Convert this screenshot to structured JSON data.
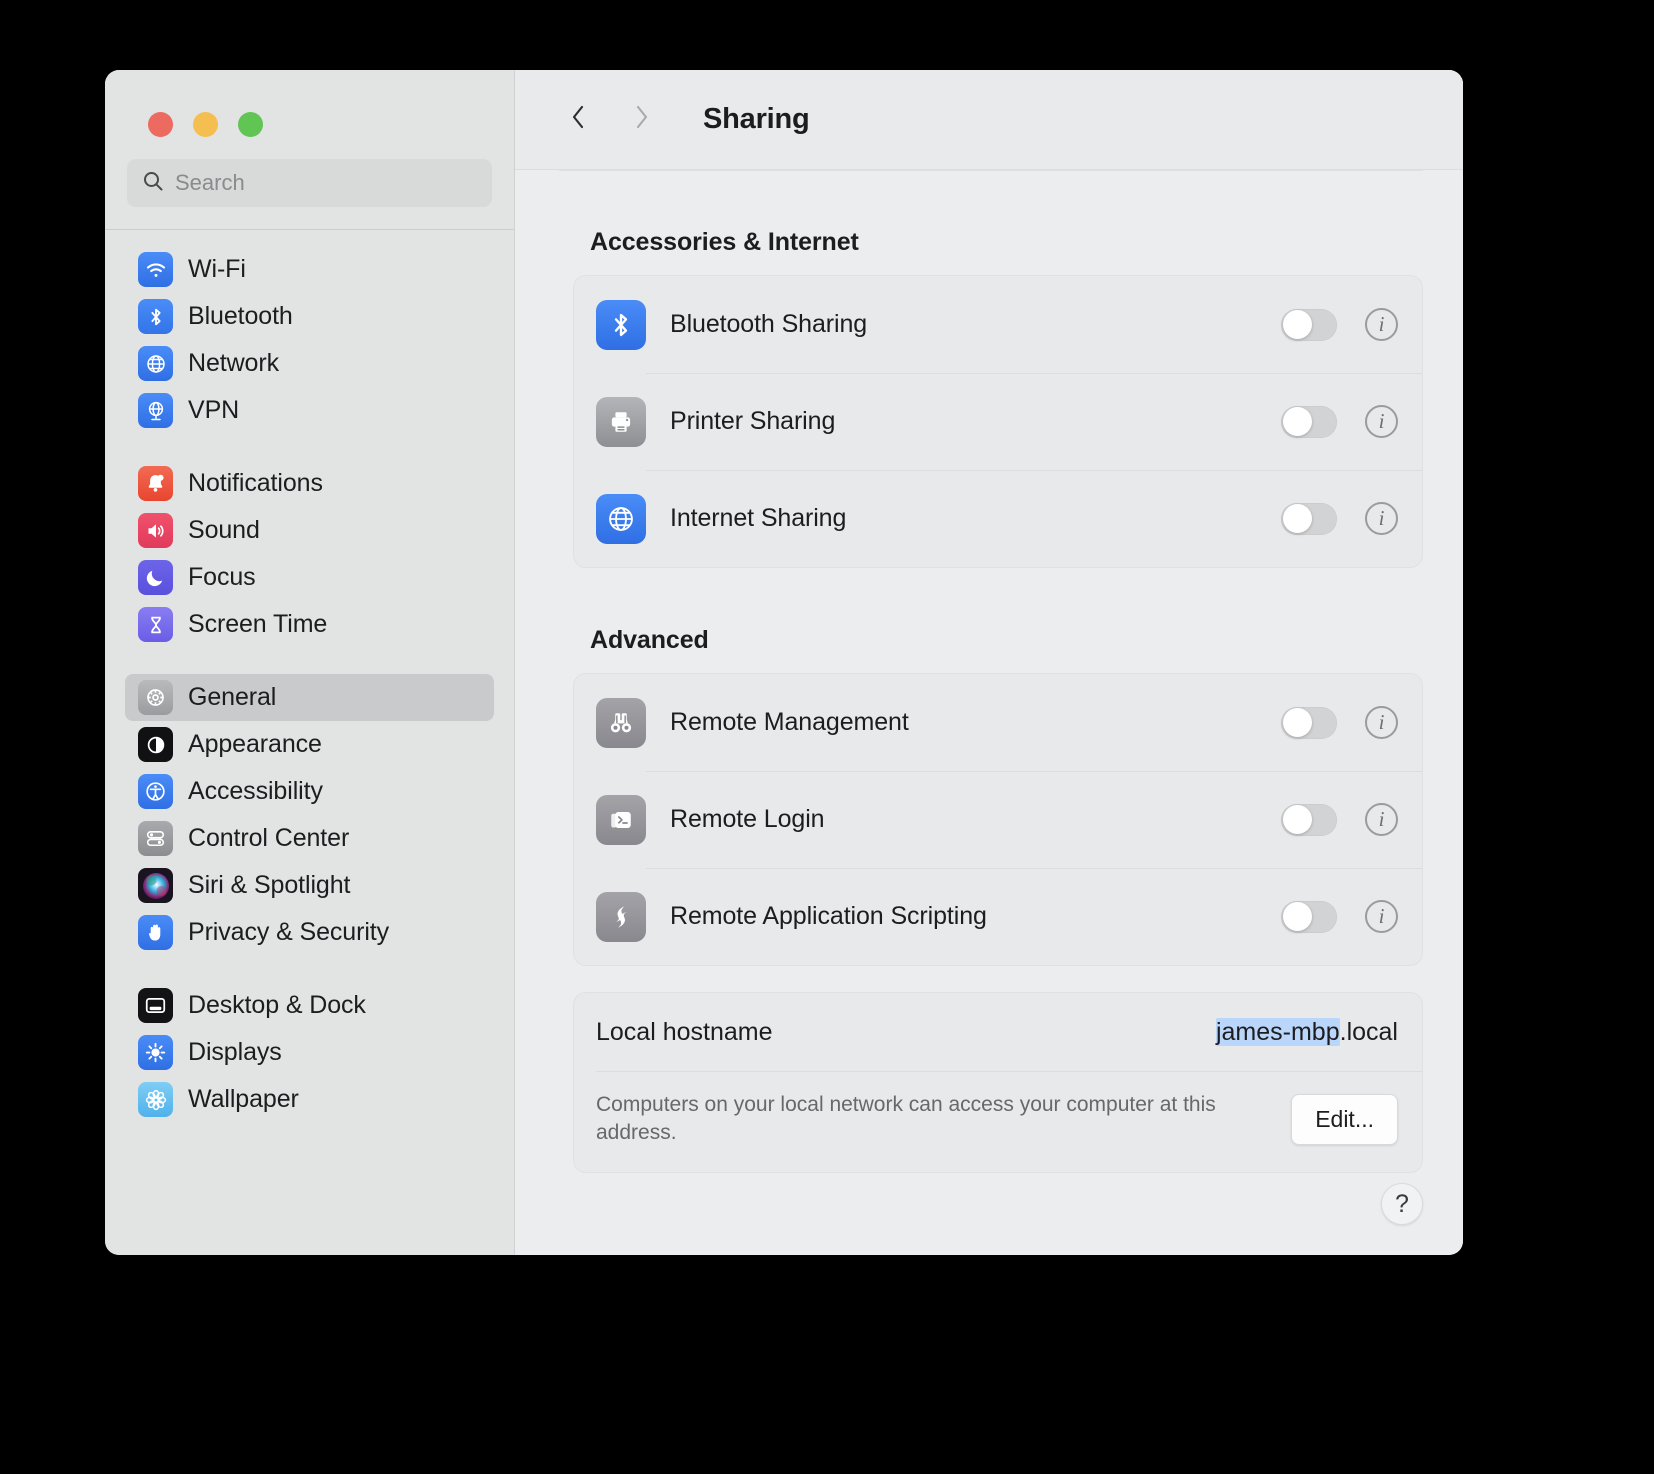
{
  "window": {
    "traffic_lights": [
      {
        "name": "close",
        "color": "#ec6a5f"
      },
      {
        "name": "minimize",
        "color": "#f4bf50"
      },
      {
        "name": "zoom",
        "color": "#61c554"
      }
    ]
  },
  "sidebar": {
    "search": {
      "placeholder": "Search",
      "value": "",
      "icon": "search-icon"
    },
    "groups": [
      {
        "items": [
          {
            "label": "Wi-Fi",
            "icon": "wifi-icon",
            "selected": false
          },
          {
            "label": "Bluetooth",
            "icon": "bluetooth-icon",
            "selected": false
          },
          {
            "label": "Network",
            "icon": "globe-icon",
            "selected": false
          },
          {
            "label": "VPN",
            "icon": "vpn-globe-icon",
            "selected": false
          }
        ]
      },
      {
        "items": [
          {
            "label": "Notifications",
            "icon": "bell-icon",
            "selected": false
          },
          {
            "label": "Sound",
            "icon": "speaker-icon",
            "selected": false
          },
          {
            "label": "Focus",
            "icon": "moon-icon",
            "selected": false
          },
          {
            "label": "Screen Time",
            "icon": "hourglass-icon",
            "selected": false
          }
        ]
      },
      {
        "items": [
          {
            "label": "General",
            "icon": "gear-icon",
            "selected": true
          },
          {
            "label": "Appearance",
            "icon": "appearance-icon",
            "selected": false
          },
          {
            "label": "Accessibility",
            "icon": "accessibility-icon",
            "selected": false
          },
          {
            "label": "Control Center",
            "icon": "control-center-icon",
            "selected": false
          },
          {
            "label": "Siri & Spotlight",
            "icon": "siri-icon",
            "selected": false
          },
          {
            "label": "Privacy & Security",
            "icon": "hand-icon",
            "selected": false
          }
        ]
      },
      {
        "items": [
          {
            "label": "Desktop & Dock",
            "icon": "desktop-dock-icon",
            "selected": false
          },
          {
            "label": "Displays",
            "icon": "brightness-icon",
            "selected": false
          },
          {
            "label": "Wallpaper",
            "icon": "wallpaper-icon",
            "selected": false
          }
        ]
      }
    ]
  },
  "toolbar": {
    "back_icon": "chevron-left-icon",
    "forward_icon": "chevron-right-icon",
    "title": "Sharing"
  },
  "main": {
    "sections": [
      {
        "title": "Accessories & Internet",
        "rows": [
          {
            "label": "Bluetooth Sharing",
            "icon": "bluetooth-sharing-icon",
            "toggle": "off",
            "info": "i"
          },
          {
            "label": "Printer Sharing",
            "icon": "printer-icon",
            "toggle": "off",
            "info": "i"
          },
          {
            "label": "Internet Sharing",
            "icon": "internet-globe-icon",
            "toggle": "off",
            "info": "i"
          }
        ]
      },
      {
        "title": "Advanced",
        "rows": [
          {
            "label": "Remote Management",
            "icon": "binoculars-icon",
            "toggle": "off",
            "info": "i"
          },
          {
            "label": "Remote Login",
            "icon": "terminal-icon",
            "toggle": "off",
            "info": "i"
          },
          {
            "label": "Remote Application Scripting",
            "icon": "script-bolt-icon",
            "toggle": "off",
            "info": "i"
          }
        ]
      }
    ],
    "hostname": {
      "label": "Local hostname",
      "value_selected": "james-mbp",
      "value_rest": ".local",
      "description": "Computers on your local network can access your computer at this address.",
      "edit_label": "Edit..."
    },
    "help_label": "?"
  },
  "colors": {
    "accent_blue": "#3d7fee",
    "selection_blue": "#bad6fb",
    "sidebar_bg": "#e2e3e3",
    "detail_bg": "#ecedee",
    "card_bg": "#e8e9ea"
  }
}
